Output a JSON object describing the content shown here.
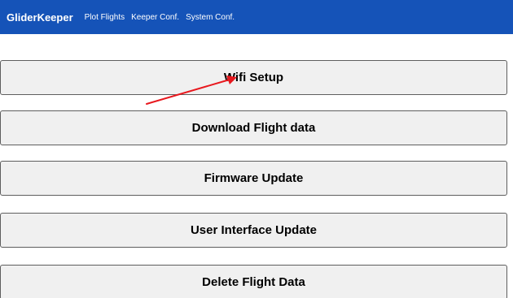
{
  "navbar": {
    "brand": "GliderKeeper",
    "links": [
      "Plot Flights",
      "Keeper Conf.",
      "System Conf."
    ],
    "background_color": "#1553b8"
  },
  "actions": [
    "Wifi Setup",
    "Download Flight data",
    "Firmware Update",
    "User Interface Update",
    "Delete Flight Data"
  ],
  "annotation": {
    "icon": "red-arrow-icon",
    "color": "#e8181e"
  }
}
